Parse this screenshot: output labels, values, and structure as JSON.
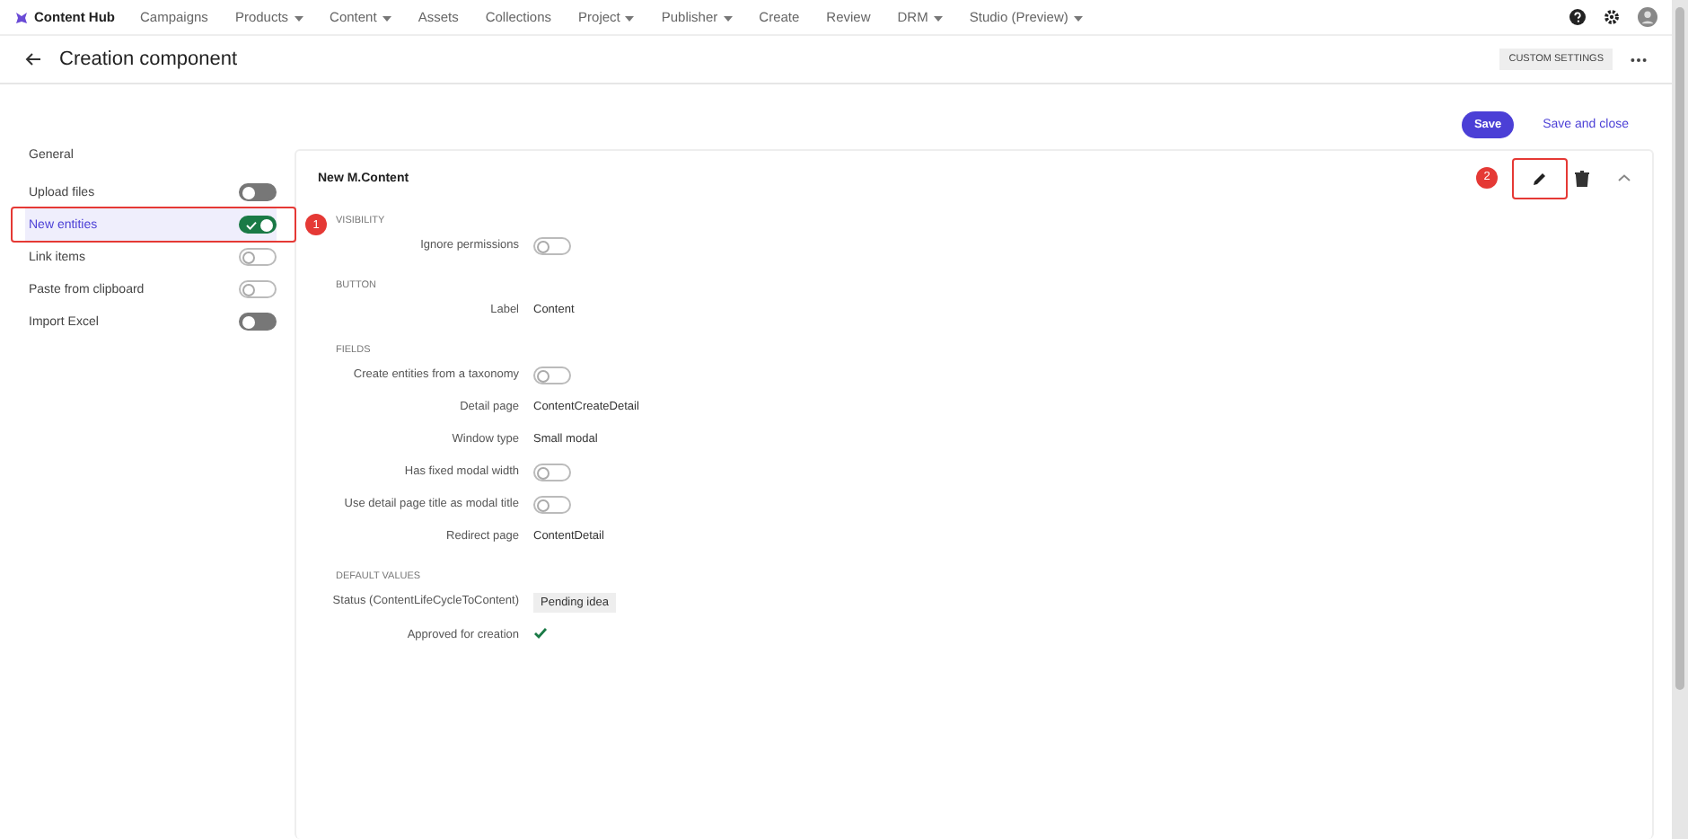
{
  "brand": "Content Hub",
  "nav": [
    {
      "label": "Campaigns",
      "dropdown": false
    },
    {
      "label": "Products",
      "dropdown": true
    },
    {
      "label": "Content",
      "dropdown": true
    },
    {
      "label": "Assets",
      "dropdown": false
    },
    {
      "label": "Collections",
      "dropdown": false
    },
    {
      "label": "Project",
      "dropdown": true
    },
    {
      "label": "Publisher",
      "dropdown": true
    },
    {
      "label": "Create",
      "dropdown": false
    },
    {
      "label": "Review",
      "dropdown": false
    },
    {
      "label": "DRM",
      "dropdown": true
    },
    {
      "label": "Studio (Preview)",
      "dropdown": true
    }
  ],
  "page_title": "Creation component",
  "custom_settings": "CUSTOM SETTINGS",
  "sidebar": {
    "heading": "General",
    "items": [
      {
        "label": "Upload files",
        "selected": false,
        "on": false,
        "disabled": true
      },
      {
        "label": "New entities",
        "selected": true,
        "on": true,
        "disabled": false,
        "marker": "1"
      },
      {
        "label": "Link items",
        "selected": false,
        "on": false,
        "disabled": false
      },
      {
        "label": "Paste from clipboard",
        "selected": false,
        "on": false,
        "disabled": false
      },
      {
        "label": "Import Excel",
        "selected": false,
        "on": false,
        "disabled": true
      }
    ]
  },
  "actions": {
    "save": "Save",
    "save_and_close": "Save and close"
  },
  "panel": {
    "title": "New M.Content",
    "edit_marker": "2",
    "sections": [
      {
        "heading": "VISIBILITY",
        "rows": [
          {
            "kind": "toggle",
            "label": "Ignore permissions",
            "on": false
          }
        ]
      },
      {
        "heading": "BUTTON",
        "rows": [
          {
            "kind": "text",
            "label": "Label",
            "value": "Content"
          }
        ]
      },
      {
        "heading": "FIELDS",
        "rows": [
          {
            "kind": "toggle",
            "label": "Create entities from a taxonomy",
            "on": false
          },
          {
            "kind": "text",
            "label": "Detail page",
            "value": "ContentCreateDetail"
          },
          {
            "kind": "text",
            "label": "Window type",
            "value": "Small modal"
          },
          {
            "kind": "toggle",
            "label": "Has fixed modal width",
            "on": false
          },
          {
            "kind": "toggle",
            "label": "Use detail page title as modal title",
            "on": false
          },
          {
            "kind": "text",
            "label": "Redirect page",
            "value": "ContentDetail"
          }
        ]
      },
      {
        "heading": "DEFAULT VALUES",
        "rows": [
          {
            "kind": "tag",
            "label": "Status (ContentLifeCycleToContent)",
            "value": "Pending idea"
          },
          {
            "kind": "check",
            "label": "Approved for creation",
            "on": true
          }
        ]
      }
    ]
  }
}
